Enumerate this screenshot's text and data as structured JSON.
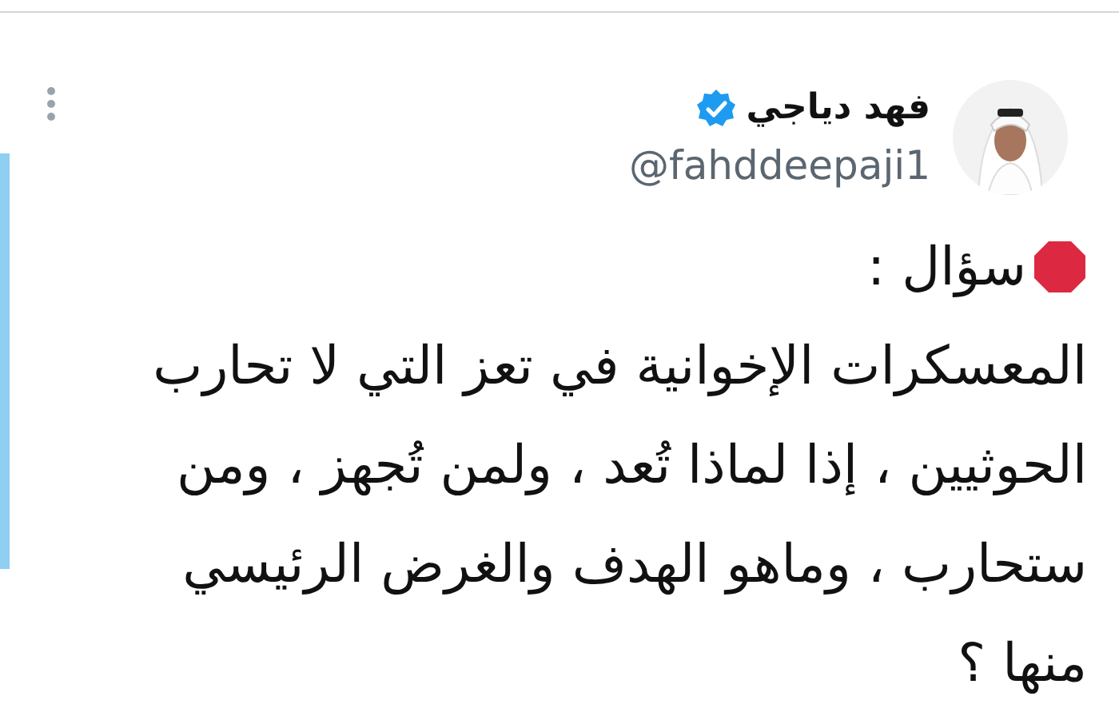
{
  "author": {
    "name": "فهد دياجي",
    "verified": true,
    "handle": "@fahddeepaji1"
  },
  "tweet": {
    "heading": "سؤال :",
    "lines": [
      "المعسكرات الإخوانية في تعز التي لا تحارب",
      "الحوثيين ،  إذا لماذا تُعد ، ولمن تُجهز ،  ومن",
      "ستحارب ، وماهو الهدف والغرض الرئيسي",
      "منها ؟"
    ]
  }
}
